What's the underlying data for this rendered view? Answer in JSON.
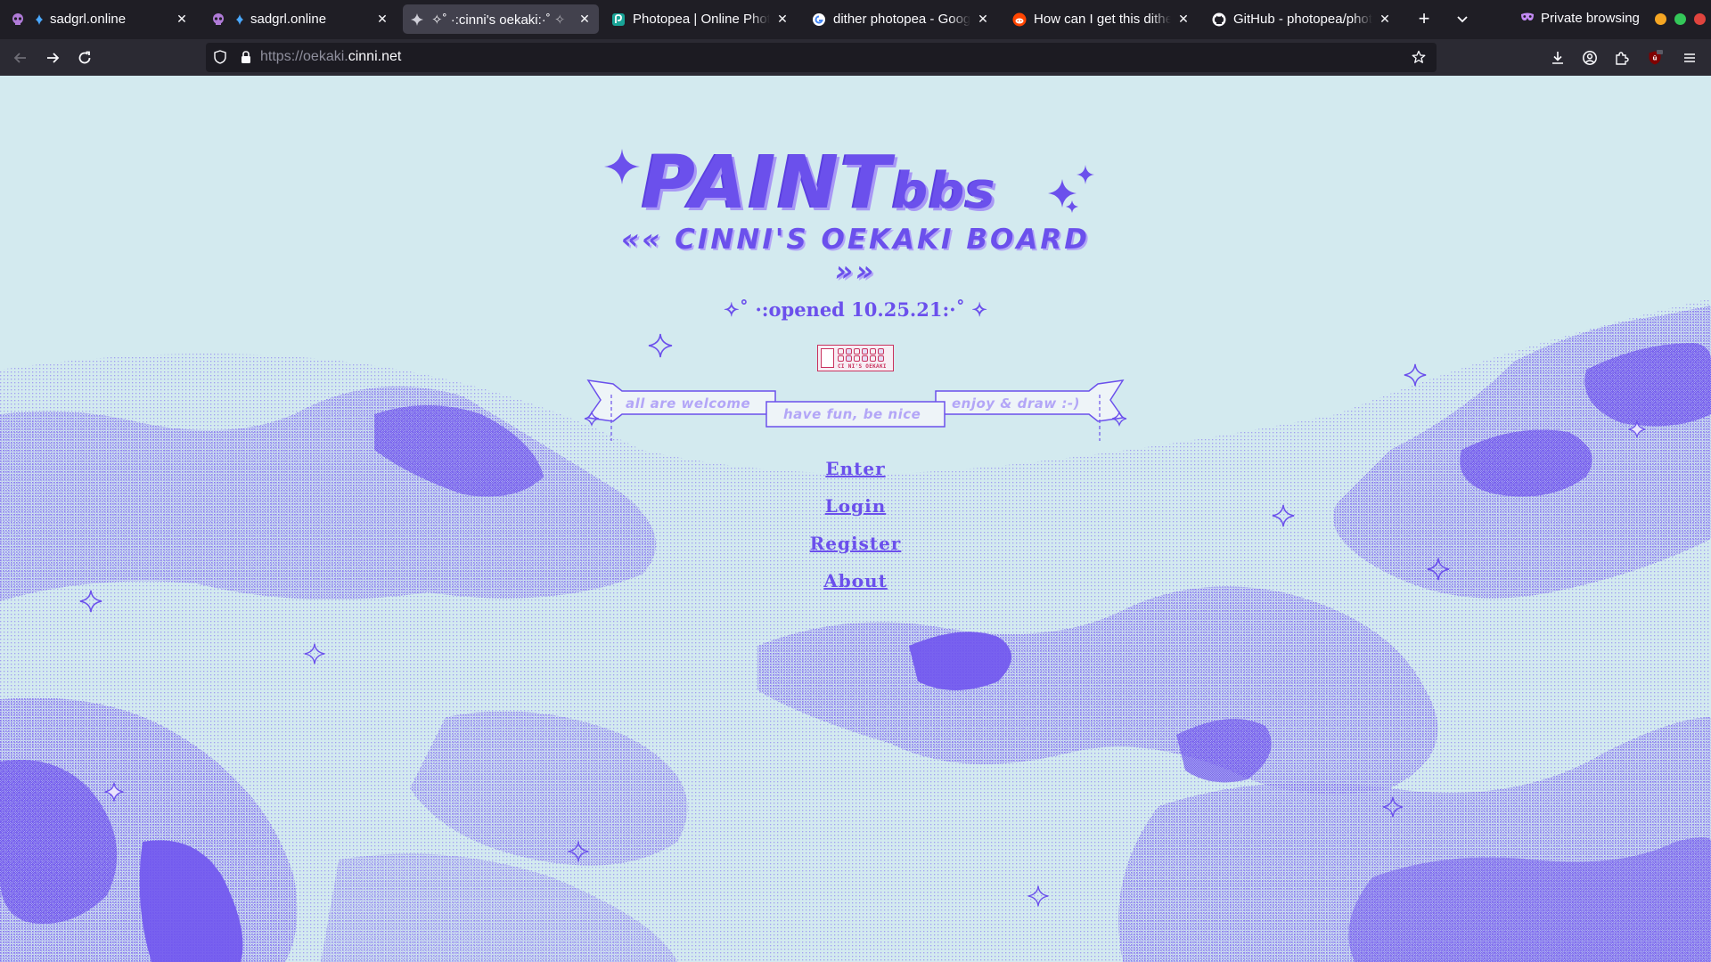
{
  "browser": {
    "tabs": [
      {
        "title": "sadgrl.online",
        "icon": "skull-icon",
        "active": false
      },
      {
        "title": "sadgrl.online",
        "icon": "skull-icon",
        "active": false
      },
      {
        "title": "✧˚ ·:cinni's oekaki:·˚ ✧",
        "icon": "sparkle-icon",
        "active": true
      },
      {
        "title": "Photopea | Online Photo Editor",
        "icon": "photopea-icon",
        "active": false
      },
      {
        "title": "dither photopea - Google Search",
        "icon": "google-icon",
        "active": false
      },
      {
        "title": "How can I get this dither effect",
        "icon": "reddit-icon",
        "active": false
      },
      {
        "title": "GitHub - photopea/photopea",
        "icon": "github-icon",
        "active": false
      }
    ],
    "private_label": "Private browsing",
    "url_prefix": "https://oekaki.",
    "url_host": "cinni.net"
  },
  "page": {
    "logo_main_big": "PAINT",
    "logo_main_small": "bbs",
    "logo_subtitle": "«« CINNI'S OEKAKI BOARD »»",
    "opened_text": "✧˚ ·:opened 10.25.21:·˚ ✧",
    "badge_text": "CI NI'S OEKAKI",
    "ribbons": {
      "left": "all are welcome",
      "center": "have fun, be nice",
      "right": "enjoy & draw :-)"
    },
    "nav_links": {
      "enter": "Enter",
      "login": "Login",
      "register": "Register",
      "about": "About"
    }
  },
  "colors": {
    "background": "#d3eaef",
    "accent": "#6b50ec",
    "cloud": "#7a5ff0",
    "ribbon_text": "#b3a6f7"
  }
}
